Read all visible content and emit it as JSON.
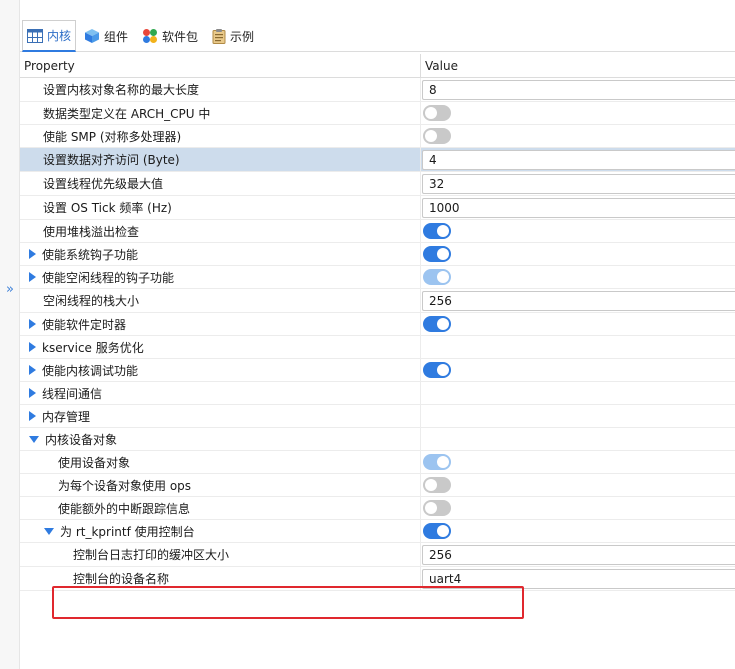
{
  "tabs": [
    {
      "label": "内核",
      "icon": "kernel-grid-icon",
      "active": true
    },
    {
      "label": "组件",
      "icon": "cube-icon",
      "active": false
    },
    {
      "label": "软件包",
      "icon": "color-dots-icon",
      "active": false
    },
    {
      "label": "示例",
      "icon": "clipboard-icon",
      "active": false
    }
  ],
  "grid": {
    "header": {
      "property": "Property",
      "value": "Value"
    },
    "rows": [
      {
        "label": "设置内核对象名称的最大长度",
        "type": "input",
        "value": "8"
      },
      {
        "label": "数据类型定义在 ARCH_CPU 中",
        "type": "toggle",
        "state": "off"
      },
      {
        "label": "使能 SMP (对称多处理器)",
        "type": "toggle",
        "state": "off"
      },
      {
        "label": "设置数据对齐访问 (Byte)",
        "type": "input",
        "value": "4",
        "selected": true
      },
      {
        "label": "设置线程优先级最大值",
        "type": "input",
        "value": "32"
      },
      {
        "label": "设置 OS Tick 频率 (Hz)",
        "type": "input",
        "value": "1000"
      },
      {
        "label": "使用堆栈溢出检查",
        "type": "toggle",
        "state": "on"
      },
      {
        "label": "使能系统钩子功能",
        "type": "toggle",
        "state": "on",
        "caret": "right"
      },
      {
        "label": "使能空闲线程的钩子功能",
        "type": "toggle",
        "state": "disabled-on",
        "caret": "right"
      },
      {
        "label": "空闲线程的栈大小",
        "type": "input",
        "value": "256"
      },
      {
        "label": "使能软件定时器",
        "type": "toggle",
        "state": "on",
        "caret": "right"
      },
      {
        "label": "kservice 服务优化",
        "type": "none",
        "caret": "right"
      },
      {
        "label": "使能内核调试功能",
        "type": "toggle",
        "state": "on",
        "caret": "right"
      },
      {
        "label": "线程间通信",
        "type": "none",
        "caret": "right"
      },
      {
        "label": "内存管理",
        "type": "none",
        "caret": "right"
      },
      {
        "label": "内核设备对象",
        "type": "none",
        "caret": "down"
      },
      {
        "label": "使用设备对象",
        "type": "toggle",
        "state": "disabled-on",
        "indent": 1
      },
      {
        "label": "为每个设备对象使用 ops",
        "type": "toggle",
        "state": "off",
        "indent": 1
      },
      {
        "label": "使能额外的中断跟踪信息",
        "type": "toggle",
        "state": "off",
        "indent": 1
      },
      {
        "label": "为 rt_kprintf 使用控制台",
        "type": "toggle",
        "state": "on",
        "caret": "down",
        "indent": 1
      },
      {
        "label": "控制台日志打印的缓冲区大小",
        "type": "input",
        "value": "256",
        "indent": 2
      },
      {
        "label": "控制台的设备名称",
        "type": "input",
        "value": "uart4",
        "indent": 2
      }
    ]
  },
  "colors": {
    "accent": "#2f7be0",
    "selected_row": "#cddcec",
    "highlight_box": "#e0282e"
  }
}
